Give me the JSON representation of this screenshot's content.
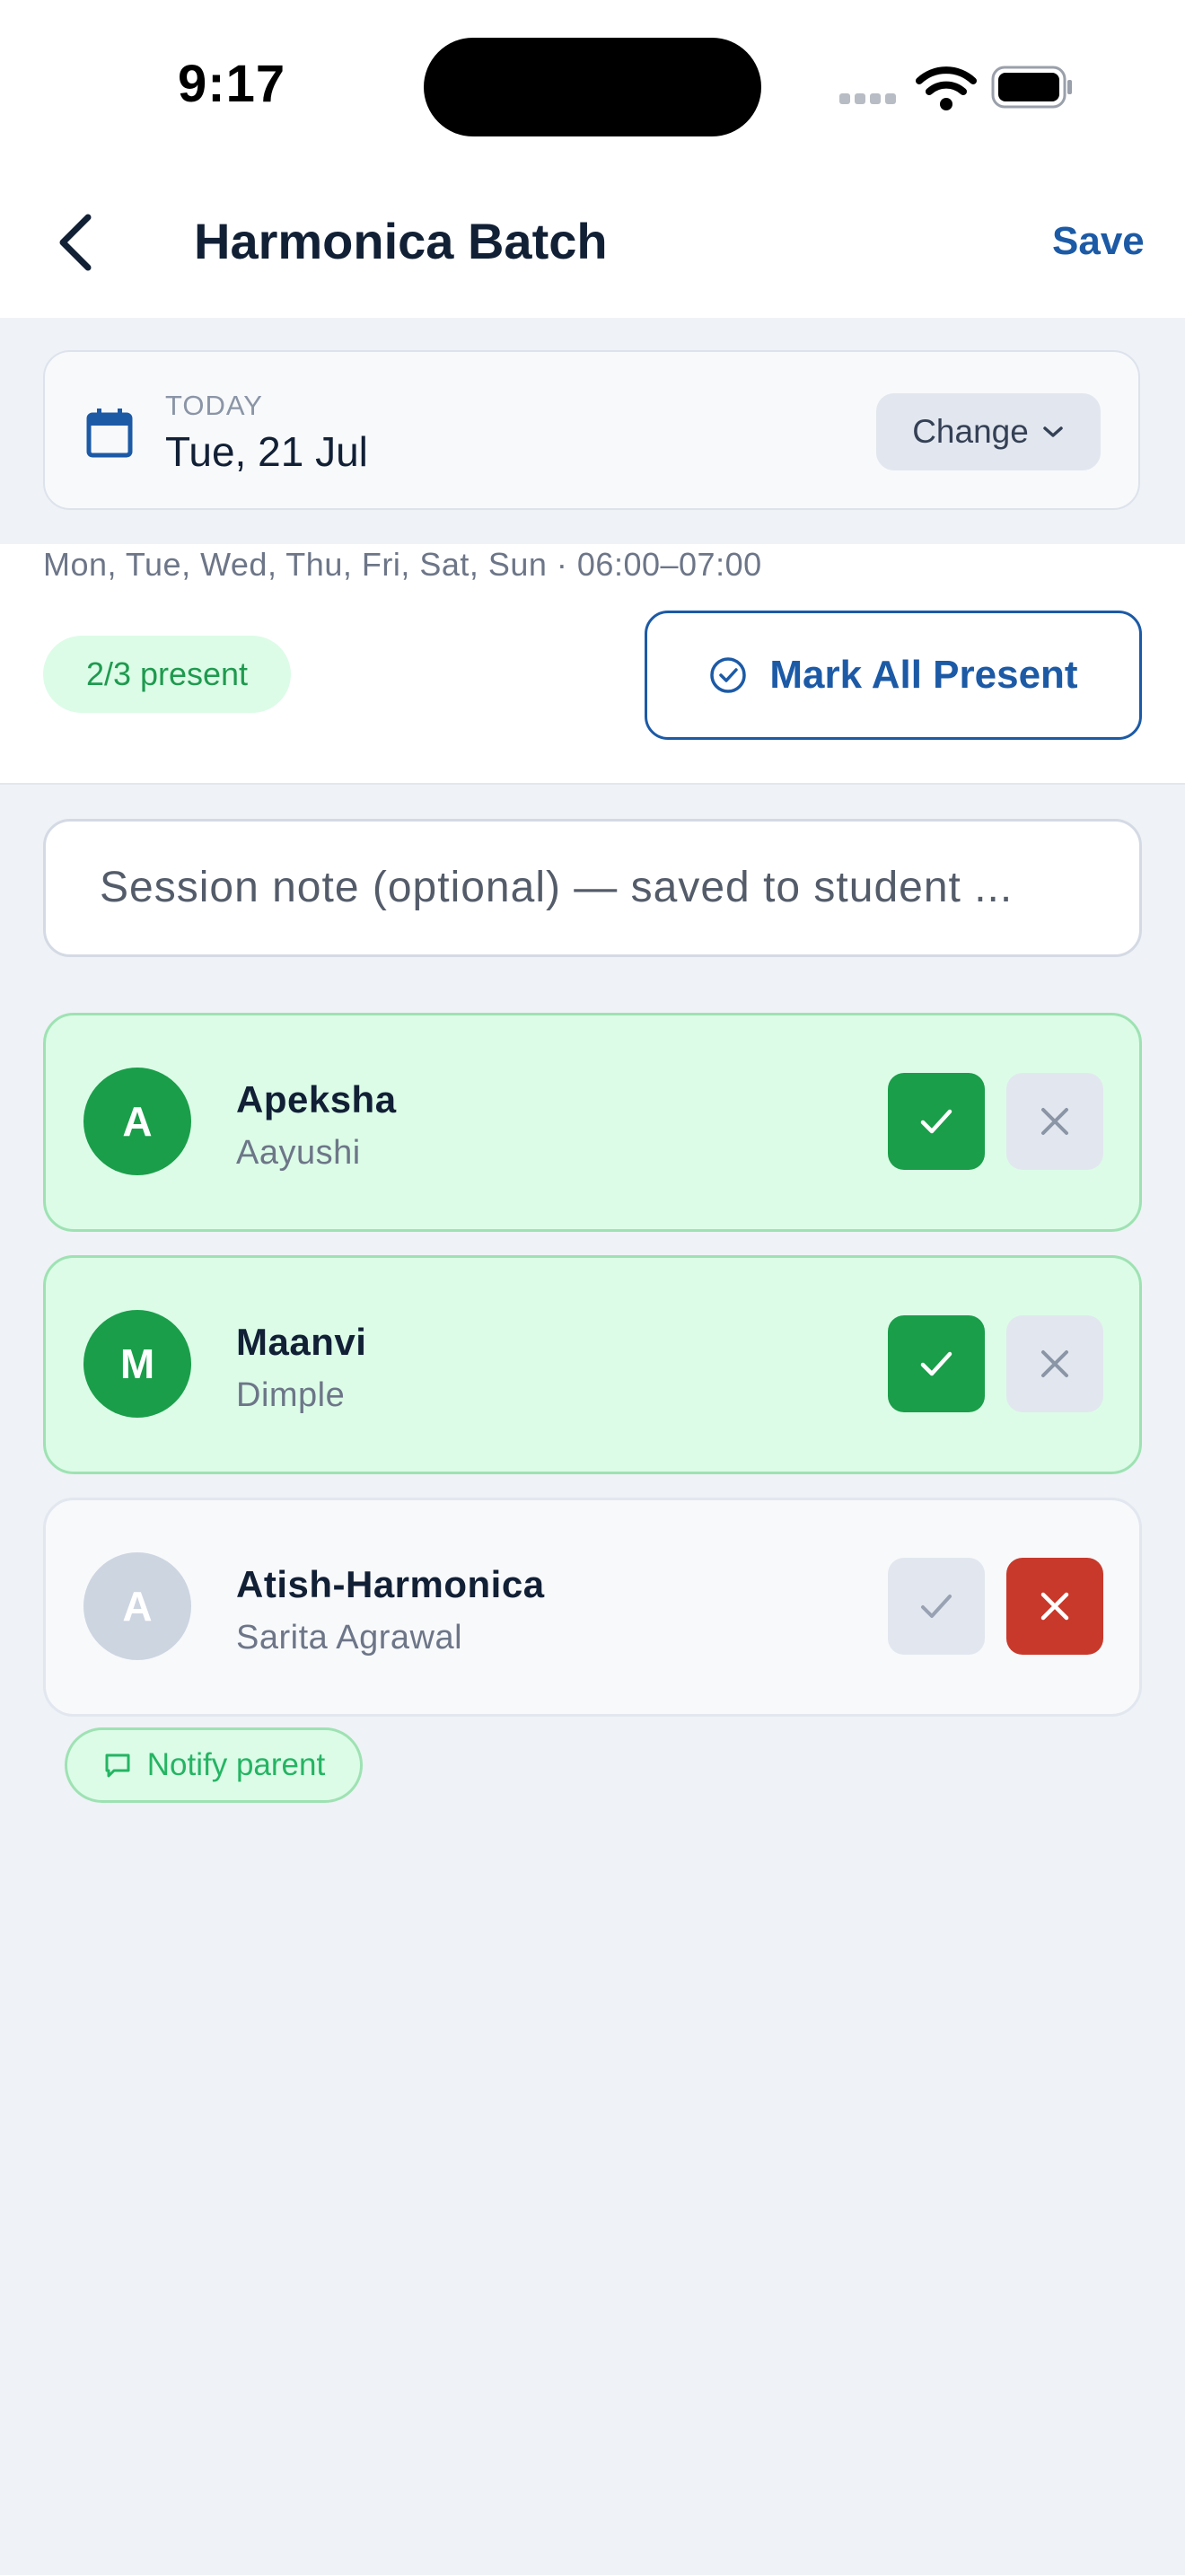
{
  "status_bar": {
    "time": "9:17"
  },
  "nav": {
    "title": "Harmonica Batch",
    "save_label": "Save"
  },
  "date_card": {
    "caption": "TODAY",
    "date": "Tue, 21 Jul",
    "change_label": "Change"
  },
  "schedule": "Mon, Tue, Wed, Thu, Fri, Sat, Sun · 06:00–07:00",
  "present_count": "2/3 present",
  "mark_all_label": "Mark All Present",
  "note": {
    "placeholder": "Session note (optional) — saved to student ..."
  },
  "students": [
    {
      "initial": "A",
      "name": "Apeksha",
      "parent": "Aayushi",
      "status": "present"
    },
    {
      "initial": "M",
      "name": "Maanvi",
      "parent": "Dimple",
      "status": "present"
    },
    {
      "initial": "A",
      "name": "Atish-Harmonica",
      "parent": "Sarita Agrawal",
      "status": "absent"
    }
  ],
  "notify_label": "Notify parent",
  "colors": {
    "accent": "#1c5aa6",
    "present": "#1a9e4a",
    "absent": "#c8392b",
    "present_bg": "#dcfce7"
  }
}
